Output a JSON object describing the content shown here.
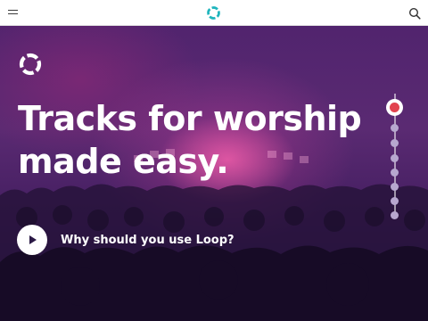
{
  "header": {
    "menu_icon": "hamburger-menu-icon",
    "logo_icon": "loop-logo-icon",
    "search_icon": "search-icon",
    "logo_color": "#1fb5bd"
  },
  "hero": {
    "logo_icon": "loop-logo-icon",
    "headline_line1": "Tracks for worship",
    "headline_line2": "made easy.",
    "cta_label": "Why should you use Loop?",
    "cta_icon": "play-icon",
    "pager": {
      "count": 8,
      "active_index": 0,
      "active_color": "#e2434f"
    }
  }
}
